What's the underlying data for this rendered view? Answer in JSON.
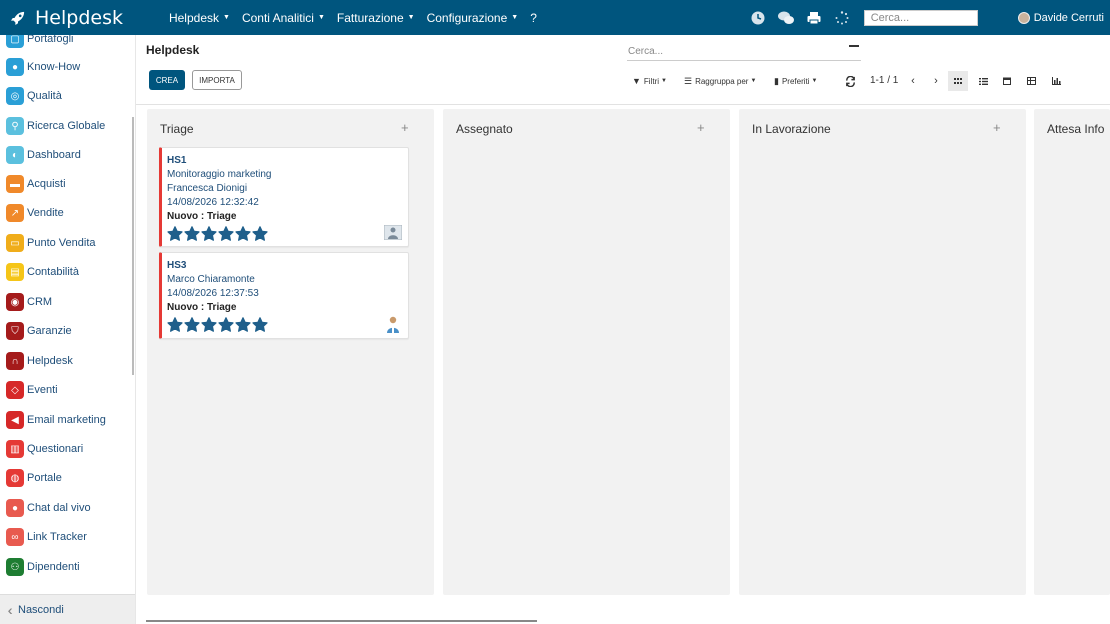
{
  "topbar": {
    "app_name": "Helpdesk",
    "menu": [
      {
        "label": "Helpdesk"
      },
      {
        "label": "Conti Analitici"
      },
      {
        "label": "Fatturazione"
      },
      {
        "label": "Configurazione"
      },
      {
        "label": "?"
      }
    ],
    "search_placeholder": "Cerca...",
    "user_name": "Davide Cerruti",
    "icons": [
      "clock-icon",
      "chat-icon",
      "print-icon",
      "spinner-icon"
    ],
    "bg_color": "#00557e"
  },
  "sidebar": {
    "items": [
      {
        "label": "Portafogli",
        "color": "#2a9fd6",
        "icon": "wallet-icon"
      },
      {
        "label": "Know-How",
        "color": "#2a9fd6",
        "icon": "brain-icon"
      },
      {
        "label": "Qualità",
        "color": "#2a9fd6",
        "icon": "quality-icon"
      },
      {
        "label": "Ricerca Globale",
        "color": "#5bc0de",
        "icon": "search-icon"
      },
      {
        "label": "Dashboard",
        "color": "#5bc0de",
        "icon": "dashboard-icon"
      },
      {
        "label": "Acquisti",
        "color": "#f0892a",
        "icon": "purchase-icon"
      },
      {
        "label": "Vendite",
        "color": "#f0892a",
        "icon": "sales-icon"
      },
      {
        "label": "Punto Vendita",
        "color": "#f0ad1a",
        "icon": "pos-icon"
      },
      {
        "label": "Contabilità",
        "color": "#f5c518",
        "icon": "accounting-icon"
      },
      {
        "label": "CRM",
        "color": "#a51b1b",
        "icon": "crm-icon"
      },
      {
        "label": "Garanzie",
        "color": "#a51b1b",
        "icon": "warranty-icon"
      },
      {
        "label": "Helpdesk",
        "color": "#a51b1b",
        "icon": "headset-icon"
      },
      {
        "label": "Eventi",
        "color": "#d62828",
        "icon": "event-icon"
      },
      {
        "label": "Email marketing",
        "color": "#d62828",
        "icon": "email-icon"
      },
      {
        "label": "Questionari",
        "color": "#e53935",
        "icon": "survey-icon"
      },
      {
        "label": "Portale",
        "color": "#e53935",
        "icon": "portal-icon"
      },
      {
        "label": "Chat dal vivo",
        "color": "#e85a4f",
        "icon": "chat-icon"
      },
      {
        "label": "Link Tracker",
        "color": "#e85a4f",
        "icon": "link-icon"
      },
      {
        "label": "Dipendenti",
        "color": "#1e7d32",
        "icon": "employees-icon"
      }
    ],
    "hide_label": "Nascondi"
  },
  "control_panel": {
    "breadcrumb": "Helpdesk",
    "create_label": "CREA",
    "import_label": "IMPORTA",
    "search_placeholder": "Cerca...",
    "filters_label": "Filtri",
    "groupby_label": "Raggruppa per",
    "favorites_label": "Preferiti",
    "pager": "1-1 / 1",
    "active_view": "kanban"
  },
  "kanban": {
    "columns": [
      {
        "title": "Triage",
        "cards": [
          {
            "ref": "HS1",
            "lines": [
              "Monitoraggio marketing",
              "Francesca Dionigi",
              "14/08/2026 12:32:42"
            ],
            "stage": "Nuovo : Triage",
            "stars": 6,
            "priority_color": "#e53935"
          },
          {
            "ref": "HS3",
            "lines": [
              "Marco Chiaramonte",
              "14/08/2026 12:37:53"
            ],
            "stage": "Nuovo : Triage",
            "stars": 6,
            "priority_color": "#e53935"
          }
        ]
      },
      {
        "title": "Assegnato",
        "cards": []
      },
      {
        "title": "In Lavorazione",
        "cards": []
      },
      {
        "title": "Attesa Info",
        "cards": []
      }
    ]
  }
}
